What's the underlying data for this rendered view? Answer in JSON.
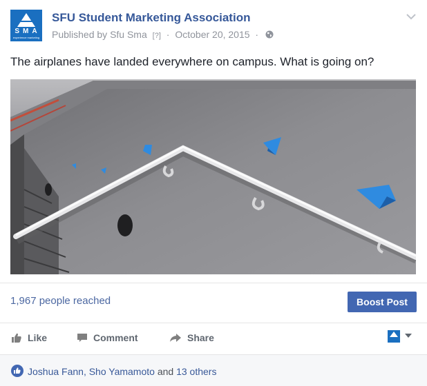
{
  "post": {
    "page_name": "SFU Student Marketing Association",
    "published_by_prefix": "Published by",
    "publisher": "Sfu Sma",
    "help_mark": "[?]",
    "date": "October 20, 2015",
    "separator": "·",
    "text": "The airplanes have landed everywhere on campus. What is going on?",
    "avatar": {
      "logo_text": "SMA",
      "logo_sub": "experience marketing"
    }
  },
  "stats": {
    "reach": "1,967 people reached",
    "boost_label": "Boost Post"
  },
  "actions": {
    "like": "Like",
    "comment": "Comment",
    "share": "Share"
  },
  "likes": {
    "names": "Joshua Fann, Sho Yamamoto",
    "conjunction": "and",
    "others": "13 others"
  },
  "colors": {
    "brand_blue": "#365899",
    "boost_bg": "#4267b2",
    "wall_gray": "#8d8d91",
    "paper_plane": "#2f8be0"
  },
  "icons": {
    "privacy": "globe-icon",
    "menu": "chevron-down-icon",
    "like": "thumbs-up-icon",
    "comment": "comment-icon",
    "share": "share-arrow-icon"
  }
}
